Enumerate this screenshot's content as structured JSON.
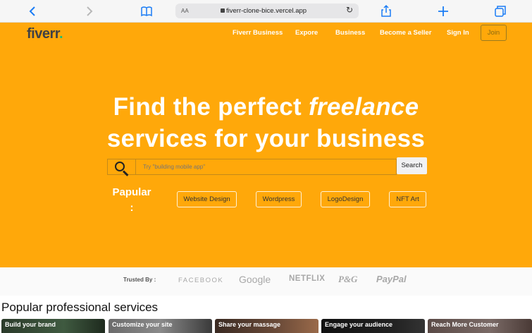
{
  "browser": {
    "back_icon": "chevron-left-icon",
    "forward_icon": "chevron-right-icon",
    "bookmarks_icon": "book-icon",
    "text_size": "AA",
    "url": "fiverr-clone-bice.vercel.app",
    "reload_icon": "reload-icon",
    "share_icon": "share-icon",
    "new_tab_icon": "plus-icon",
    "tabs_icon": "tabs-icon"
  },
  "header": {
    "logo_text": "fiverr",
    "logo_dot": ".",
    "nav": [
      "Fiverr Business",
      "Expore",
      "Business",
      "Become a Seller",
      "Sign In"
    ],
    "join_label": "Join"
  },
  "hero": {
    "headline_part1": "Find the perfect ",
    "headline_em": "freelance",
    "headline_line2": "services for your business",
    "search_placeholder": "Try \"building mobile app\"",
    "search_button": "Search",
    "popular_label": "Papular",
    "popular_colon": ":",
    "tags": [
      "Website Design",
      "Wordpress",
      "LogoDesign",
      "NFT Art"
    ]
  },
  "trusted": {
    "label": "Trusted By :",
    "brands": [
      "FACEBOOK",
      "Google",
      "NETFLIX",
      "P&G",
      "PayPal"
    ]
  },
  "services": {
    "title": "Popular professional services",
    "cards": [
      "Build your brand",
      "Customize your site",
      "Share your massage",
      "Engage your audience",
      "Reach More Customer"
    ]
  },
  "colors": {
    "hero_bg": "#ffa80a",
    "logo_dot": "#1dbf73"
  }
}
